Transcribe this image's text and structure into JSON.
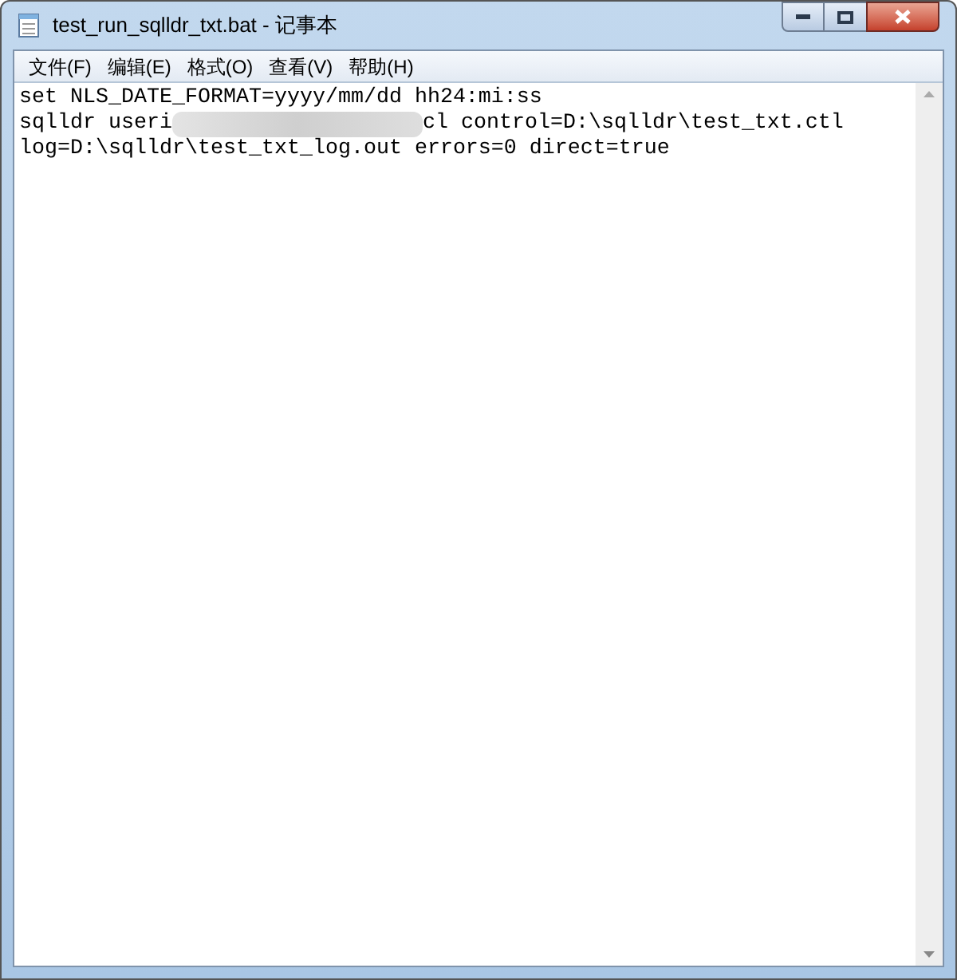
{
  "window": {
    "title": "test_run_sqlldr_txt.bat - 记事本"
  },
  "menu": [
    {
      "label": "文件(F)"
    },
    {
      "label": "编辑(E)"
    },
    {
      "label": "格式(O)"
    },
    {
      "label": "查看(V)"
    },
    {
      "label": "帮助(H)"
    }
  ],
  "editor": {
    "lines": [
      {
        "kind": "plain",
        "text": "set NLS_DATE_FORMAT=yyyy/mm/dd hh24:mi:ss"
      },
      {
        "kind": "obscured",
        "before": "sqlldr useri",
        "after": "cl control=D:\\sqlldr\\test_txt.ctl"
      },
      {
        "kind": "plain",
        "text": "log=D:\\sqlldr\\test_txt_log.out errors=0 direct=true"
      }
    ]
  }
}
